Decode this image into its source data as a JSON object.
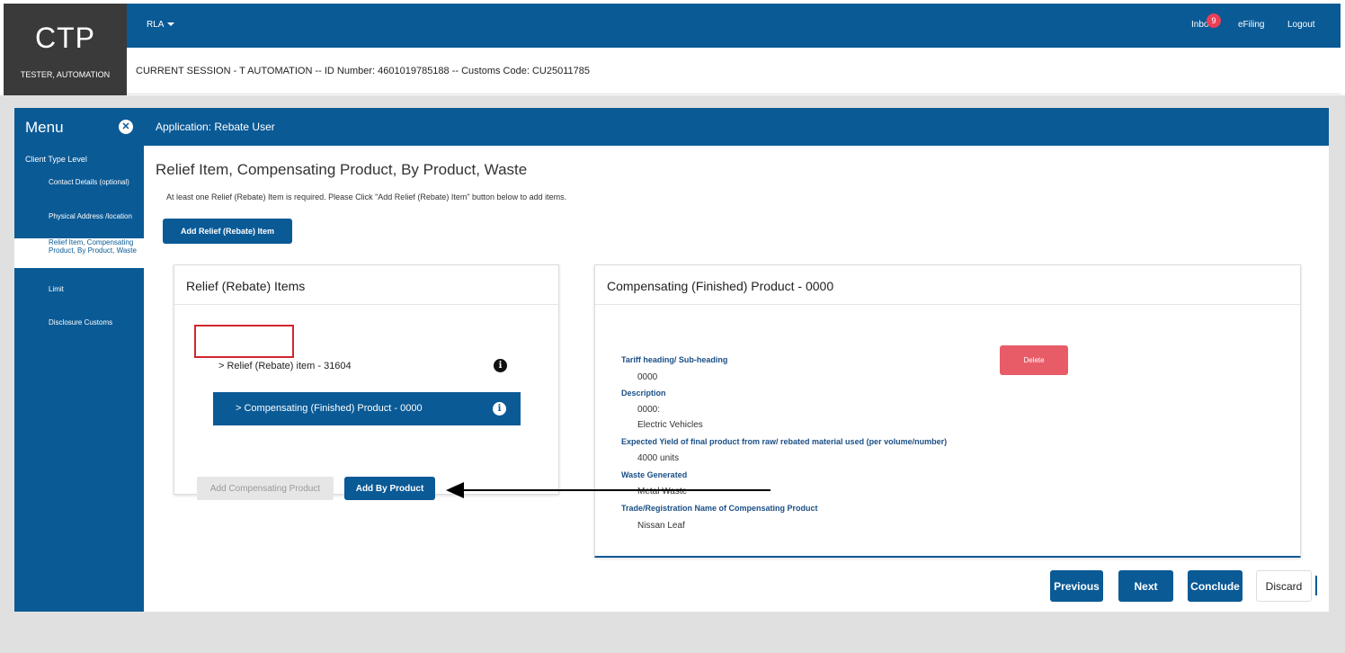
{
  "header": {
    "logo": "CTP",
    "user_name": "TESTER, AUTOMATION",
    "rla_menu": "RLA",
    "inbox_label": "Inbo",
    "inbox_count": "9",
    "efiling": "eFiling",
    "logout": "Logout",
    "session": "CURRENT SESSION - T AUTOMATION -- ID Number: 4601019785188 -- Customs Code: CU25011785"
  },
  "app": {
    "menu_title": "Menu",
    "title": "Application: Rebate User"
  },
  "sidebar": {
    "client_type": "Client Type Level",
    "items": [
      {
        "label": "Contact Details (optional)"
      },
      {
        "label": "Physical Address /location"
      },
      {
        "label": "Relief Item, Compensating Product, By Product, Waste"
      },
      {
        "label": "Limit"
      },
      {
        "label": "Disclosure Customs"
      }
    ]
  },
  "main": {
    "page_title": "Relief Item, Compensating Product, By Product, Waste",
    "intro": "At least one Relief (Rebate) Item is required. Please Click \"Add Relief (Rebate) Item\" button below to add items.",
    "add_relief_button": "Add Relief (Rebate) Item"
  },
  "relief_card": {
    "title": "Relief (Rebate) Items",
    "tree": [
      {
        "label": "Relief (Rebate) item - 31604"
      },
      {
        "label": "Compensating (Finished) Product - 0000"
      }
    ],
    "add_compensating": "Add Compensating Product",
    "add_by_product": "Add By Product"
  },
  "product_card": {
    "title": "Compensating (Finished) Product - 0000",
    "delete": "Delete",
    "fields": {
      "tariff_label": "Tariff heading/ Sub-heading",
      "tariff_value": "0000",
      "description_label": "Description",
      "description_code": "0000:",
      "description_value": "Electric Vehicles",
      "yield_label": "Expected Yield of final product from raw/ rebated material used (per volume/number)",
      "yield_value": "4000 units",
      "waste_label": "Waste Generated",
      "waste_value": "Metal Waste",
      "trade_label": "Trade/Registration Name of Compensating Product",
      "trade_value": "Nissan Leaf"
    }
  },
  "footer_buttons": {
    "previous": "Previous",
    "next": "Next",
    "conclude": "Conclude",
    "discard": "Discard"
  },
  "colors": {
    "primary": "#0a5a96",
    "danger": "#e85c68",
    "badge": "#e84058",
    "highlight": "#d0262d"
  }
}
